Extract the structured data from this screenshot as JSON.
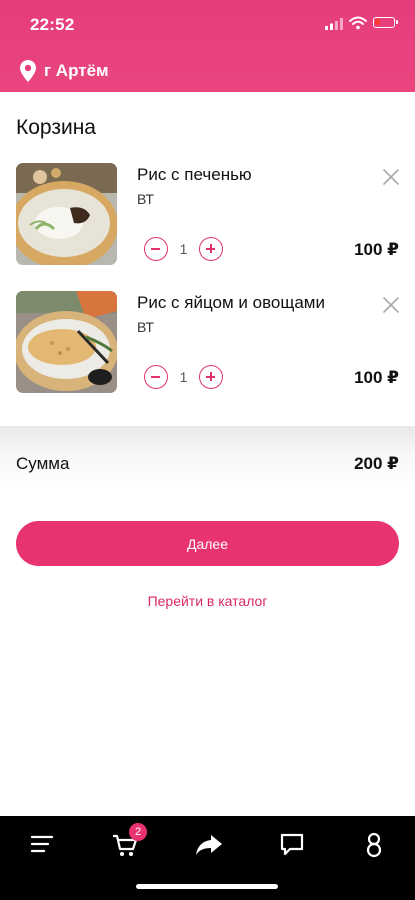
{
  "status_bar": {
    "time": "22:52"
  },
  "header": {
    "city": "г Артём"
  },
  "cart": {
    "title": "Корзина",
    "items": [
      {
        "name": "Рис с печенью",
        "shop": "ВТ",
        "quantity": "1",
        "price": "100 ₽"
      },
      {
        "name": "Рис с яйцом и овощами",
        "shop": "ВТ",
        "quantity": "1",
        "price": "100 ₽"
      }
    ]
  },
  "summary": {
    "label": "Сумма",
    "value": "200 ₽"
  },
  "actions": {
    "next_label": "Далее",
    "catalog_link": "Перейти в каталог"
  },
  "bottom_nav": {
    "items": [
      "menu-icon",
      "cart-icon",
      "share-icon",
      "chat-icon",
      "profile-icon"
    ],
    "cart_badge": "2"
  },
  "colors": {
    "accent": "#e8336e",
    "header": "#e63d7c"
  }
}
